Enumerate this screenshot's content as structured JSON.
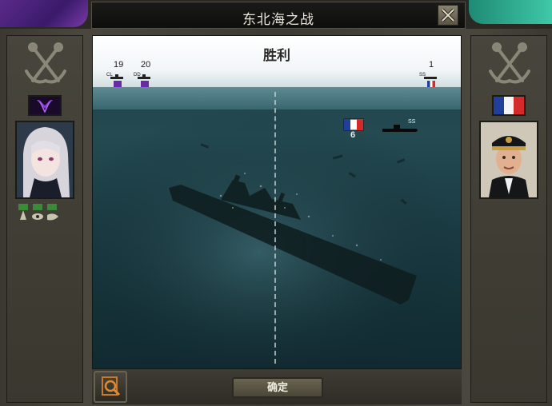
{
  "window": {
    "title": "东北海之战"
  },
  "battle": {
    "result": "胜利",
    "attacker": {
      "ships": [
        {
          "type": "CL",
          "count": "19"
        },
        {
          "type": "DD",
          "count": "20"
        }
      ]
    },
    "defender": {
      "ships": [
        {
          "type": "SS",
          "count": "1"
        }
      ],
      "sunk_count": "6",
      "sub_label": "SS"
    }
  },
  "buttons": {
    "confirm": "确定"
  },
  "colors": {
    "accent_purple": "#6a2aa8",
    "france_blue": "#1f3f9a",
    "france_red": "#d42a2a"
  }
}
